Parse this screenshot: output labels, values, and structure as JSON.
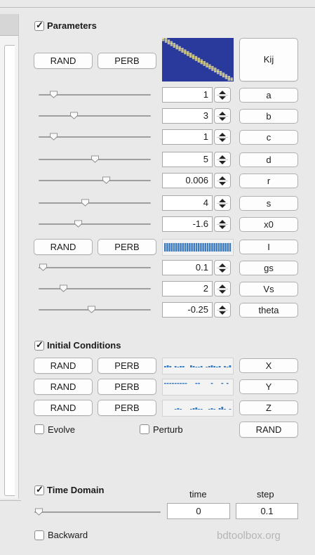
{
  "parameters": {
    "label": "Parameters",
    "checked": true,
    "rand_label": "RAND",
    "perb_label": "PERB",
    "kij_label": "Kij",
    "rows": [
      {
        "name": "a",
        "value": "1",
        "level": 0.1
      },
      {
        "name": "b",
        "value": "3",
        "level": 0.3
      },
      {
        "name": "c",
        "value": "1",
        "level": 0.1
      },
      {
        "name": "d",
        "value": "5",
        "level": 0.5
      },
      {
        "name": "r",
        "value": "0.006",
        "level": 0.61
      },
      {
        "name": "s",
        "value": "4",
        "level": 0.41
      },
      {
        "name": "x0",
        "value": "-1.6",
        "level": 0.34
      },
      {
        "name": "gs",
        "value": "0.1",
        "level": 0.0
      },
      {
        "name": "Vs",
        "value": "2",
        "level": 0.2
      },
      {
        "name": "theta",
        "value": "-0.25",
        "level": 0.47
      }
    ],
    "i_label": "I"
  },
  "initial_conditions": {
    "label": "Initial Conditions",
    "checked": true,
    "rand_label": "RAND",
    "perb_label": "PERB",
    "vars": [
      "X",
      "Y",
      "Z"
    ],
    "evolve_label": "Evolve",
    "evolve_checked": false,
    "perturb_label": "Perturb",
    "perturb_checked": false,
    "rand_all_label": "RAND"
  },
  "time_domain": {
    "label": "Time Domain",
    "checked": true,
    "time_header": "time",
    "step_header": "step",
    "time_value": "0",
    "step_value": "0.1",
    "slider_level": 0.0,
    "backward_label": "Backward",
    "backward_checked": false
  },
  "footer": {
    "brand": "bdtoolbox.org"
  },
  "colors": {
    "matrix_bg": "#2a3a9c",
    "matrix_diag": "#e6d86a",
    "spark_bar": "#3a7bbf"
  }
}
